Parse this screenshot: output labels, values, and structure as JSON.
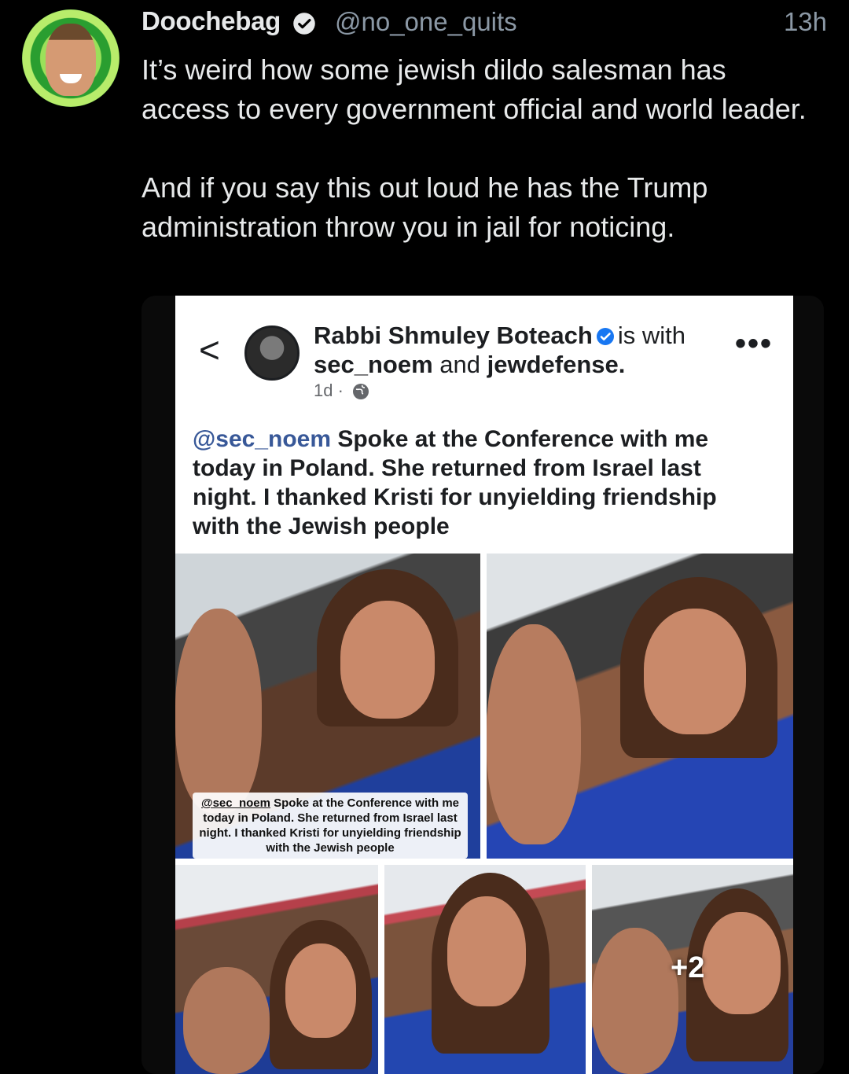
{
  "tweet": {
    "display_name": "Doochebag",
    "handle": "@no_one_quits",
    "time": "13h",
    "paragraphs": [
      "It’s weird how some jewish dildo salesman has access to every government official and world leader.",
      "And if you say this out loud he has the Trump administration throw you in jail for noticing."
    ]
  },
  "embedded_post": {
    "back_glyph": "<",
    "author": "Rabbi Shmuley Boteach",
    "is_with": "is with",
    "tag1": "sec_noem",
    "and": "and",
    "tag2": "jewdefense.",
    "age": "1d ·",
    "more_glyph": "•••",
    "mention": "@sec_noem",
    "caption": " Spoke at the Conference with me today in Poland. She returned from Israel last night. I thanked Kristi for unyielding friendship with the Jewish people",
    "photo_caption_mention": "@sec_noem",
    "photo_caption": " Spoke at the Conference with me today in Poland. She returned from Israel last night. I thanked Kristi for unyielding friendship with the Jewish people",
    "more_photos": "+2"
  },
  "colors": {
    "background": "#000000",
    "text": "#e7e9ea",
    "muted": "#8b98a5",
    "verified": "#1d9bf0",
    "fb_blue": "#1877f2"
  },
  "icons": [
    "verified-badge-icon",
    "back-chevron-icon",
    "globe-icon",
    "more-options-icon"
  ]
}
